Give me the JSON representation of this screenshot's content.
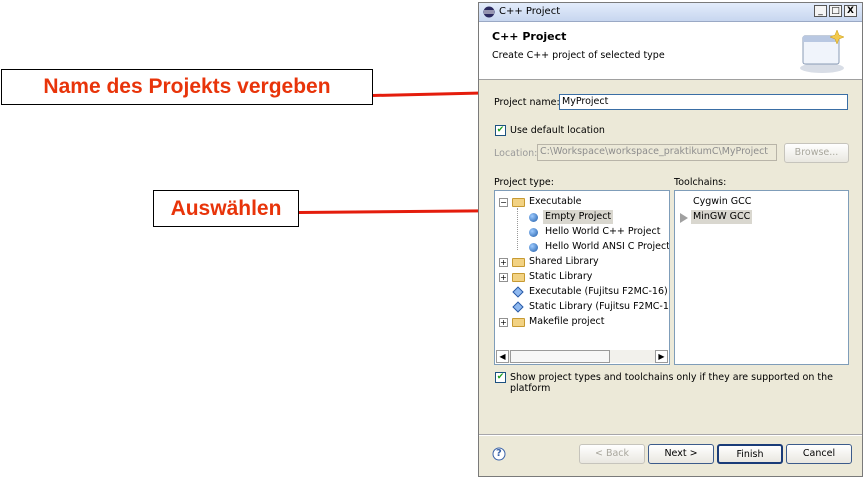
{
  "callouts": {
    "name": "Name des Projekts vergeben",
    "select": "Auswählen"
  },
  "window": {
    "title": "C++ Project",
    "controls": {
      "minimize": "_",
      "maximize": "□",
      "close": "X"
    }
  },
  "header": {
    "title": "C++ Project",
    "description": "Create C++ project of selected type"
  },
  "project_name": {
    "label": "Project name:",
    "value": "MyProject"
  },
  "use_default_location": {
    "label": "Use default location",
    "checked": true
  },
  "location": {
    "label": "Location:",
    "value": "C:\\Workspace\\workspace_praktikumC\\MyProject",
    "browse": "Browse..."
  },
  "project_type": {
    "label": "Project type:",
    "items": [
      {
        "label": "Executable",
        "expander": "−"
      },
      {
        "label": "Empty Project"
      },
      {
        "label": "Hello World C++ Project"
      },
      {
        "label": "Hello World ANSI C Project"
      },
      {
        "label": "Shared Library",
        "expander": "+"
      },
      {
        "label": "Static Library",
        "expander": "+"
      },
      {
        "label": "Executable (Fujitsu F2MC-16)"
      },
      {
        "label": "Static Library (Fujitsu F2MC-16)"
      },
      {
        "label": "Makefile project",
        "expander": "+"
      }
    ],
    "scroll_left": "◀",
    "scroll_right": "▶"
  },
  "toolchains": {
    "label": "Toolchains:",
    "items": [
      {
        "label": "Cygwin GCC"
      },
      {
        "label": "MinGW GCC"
      }
    ]
  },
  "show_supported": {
    "label": "Show project types and toolchains only if they are supported on the platform",
    "checked": true
  },
  "buttons": {
    "help": "?",
    "back": "< Back",
    "next": "Next >",
    "finish": "Finish",
    "cancel": "Cancel"
  },
  "colors": {
    "callout_text": "#e8340a",
    "arrow": "#e41c0c",
    "dialog_bg": "#ece9d8"
  }
}
